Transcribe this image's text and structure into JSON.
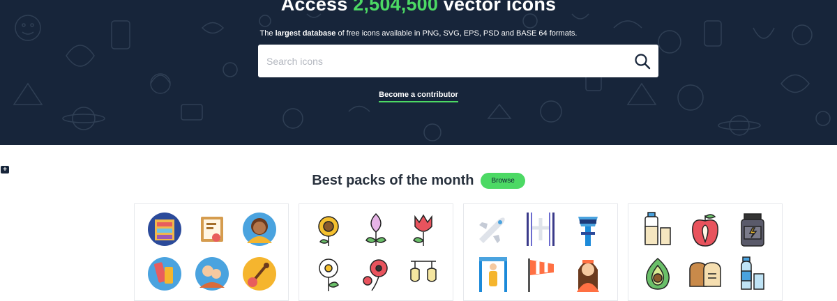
{
  "hero": {
    "title_prefix": "Access ",
    "title_count": "2,504,500",
    "title_suffix": " vector icons",
    "subtitle_prefix": "The ",
    "subtitle_bold": "largest database",
    "subtitle_suffix": " of free icons available in PNG, SVG, EPS, PSD and BASE 64 formats.",
    "contributor_link": "Become a contributor"
  },
  "search": {
    "placeholder": "Search icons",
    "value": ""
  },
  "side_button": {
    "label": "+"
  },
  "packs": {
    "title": "Best packs of the month",
    "browse_label": "Browse",
    "cards": [
      {
        "icons": [
          "bookshelf-icon",
          "certificate-icon",
          "woman-avatar-icon",
          "paint-tube-icon",
          "family-icon",
          "guitar-icon"
        ]
      },
      {
        "icons": [
          "sunflower-icon",
          "calla-lily-icon",
          "tulip-icon",
          "daisy-icon",
          "poppy-icon",
          "bellflower-icon"
        ]
      },
      {
        "icons": [
          "airplane-icon",
          "runway-icon",
          "control-tower-icon",
          "security-gate-icon",
          "windsock-icon",
          "flight-attendant-icon"
        ]
      },
      {
        "icons": [
          "milk-icon",
          "apple-icon",
          "protein-jar-icon",
          "avocado-icon",
          "bread-icon",
          "water-bottle-icon"
        ]
      }
    ]
  },
  "colors": {
    "hero_bg": "#17253a",
    "accent": "#4cd964",
    "text_dark": "#28313d"
  }
}
